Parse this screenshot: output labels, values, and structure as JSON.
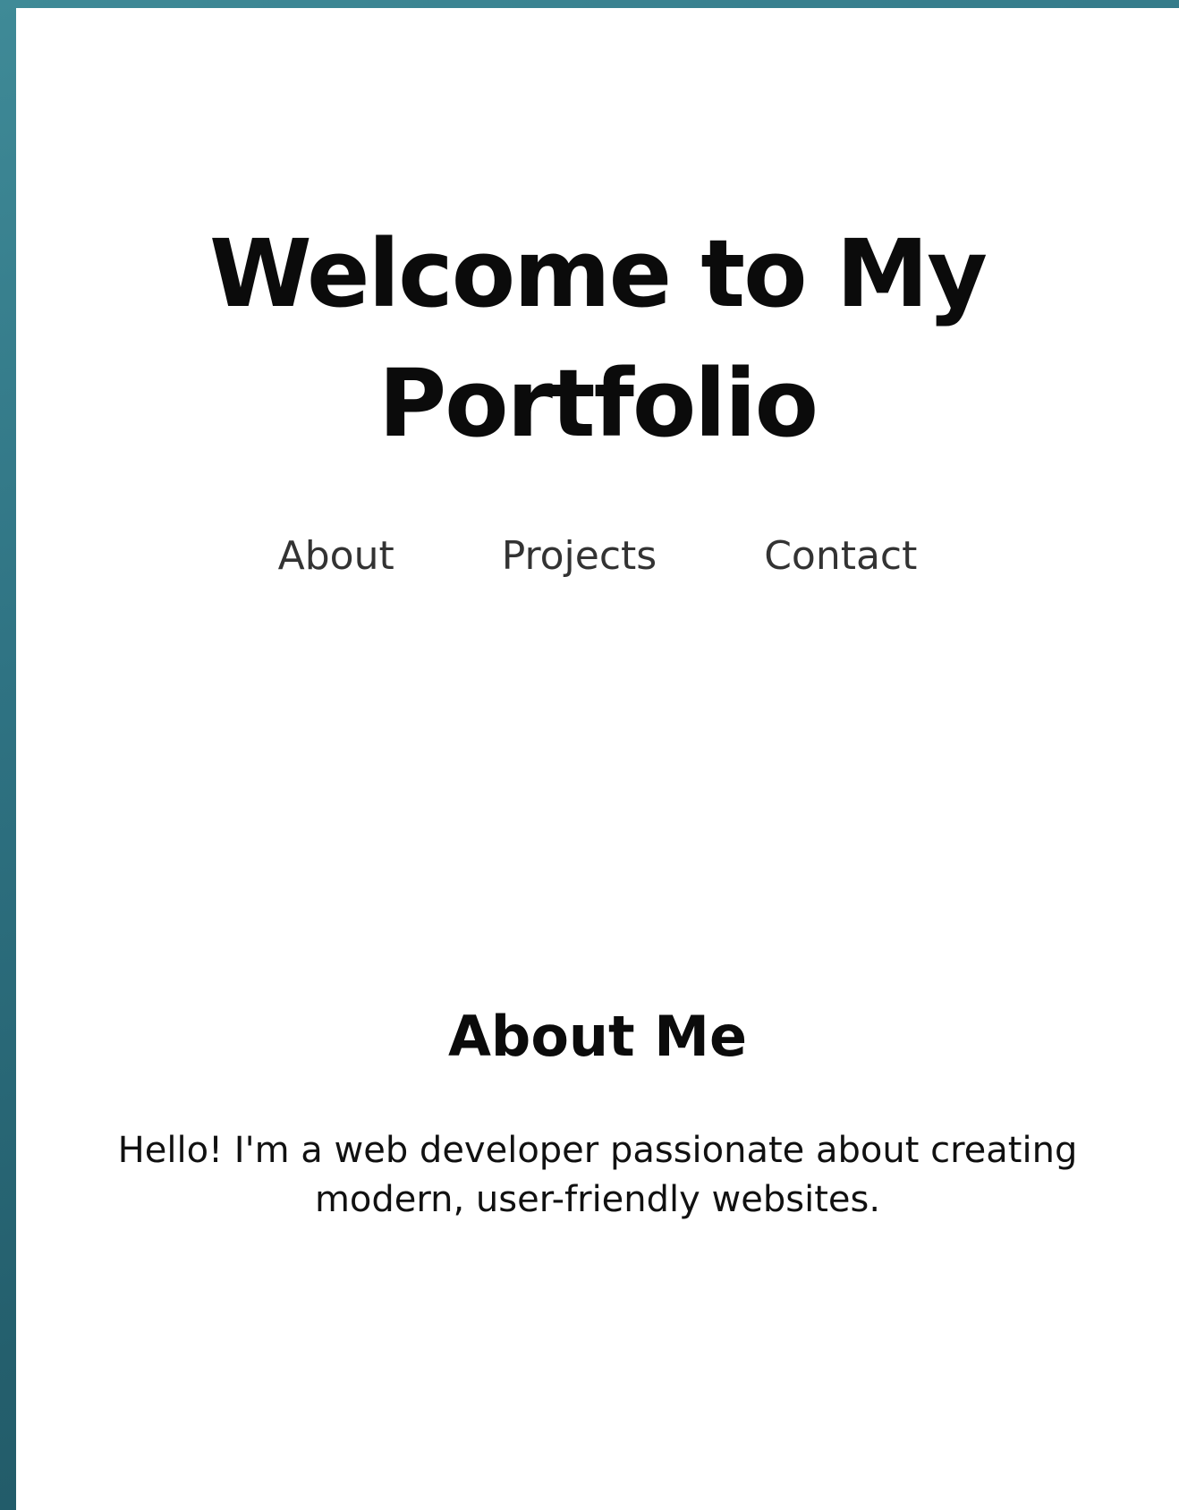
{
  "header": {
    "title": "Welcome to My Portfolio"
  },
  "nav": {
    "items": [
      {
        "label": "About"
      },
      {
        "label": "Projects"
      },
      {
        "label": "Contact"
      }
    ]
  },
  "about": {
    "heading": "About Me",
    "text": "Hello! I'm a web developer passionate about creating modern, user-friendly websites."
  },
  "colors": {
    "background": "#2f7383",
    "page": "#ffffff",
    "text": "#0b0b0b",
    "nav_text": "#333333"
  }
}
